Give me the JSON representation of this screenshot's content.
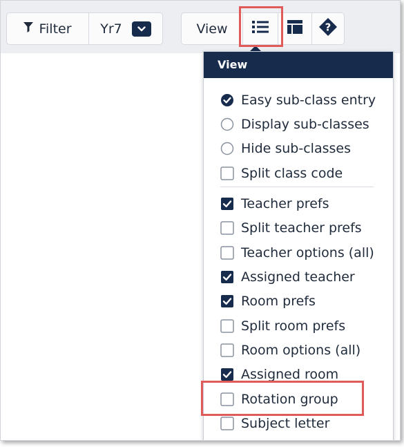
{
  "toolbar": {
    "filter_label": "Filter",
    "year_value": "Yr7",
    "view_label": "View"
  },
  "icons": {
    "filter": "funnel-icon",
    "year_dropdown": "chevron-down-icon",
    "list": "list-icon",
    "layout": "layout-icon",
    "help": "help-diamond-icon"
  },
  "colors": {
    "accent": "#172b4d",
    "highlight": "#e05a5a",
    "toolbar_bg": "#eceef1"
  },
  "view_menu": {
    "title": "View",
    "radio_options": [
      {
        "label": "Easy sub-class entry",
        "selected": true
      },
      {
        "label": "Display sub-classes",
        "selected": false
      },
      {
        "label": "Hide sub-classes",
        "selected": false
      }
    ],
    "split_class_code": {
      "label": "Split class code",
      "checked": false
    },
    "check_options": [
      {
        "label": "Teacher prefs",
        "checked": true
      },
      {
        "label": "Split teacher prefs",
        "checked": false
      },
      {
        "label": "Teacher options (all)",
        "checked": false
      },
      {
        "label": "Assigned teacher",
        "checked": true
      },
      {
        "label": "Room prefs",
        "checked": true
      },
      {
        "label": "Split room prefs",
        "checked": false
      },
      {
        "label": "Room options (all)",
        "checked": false
      },
      {
        "label": "Assigned room",
        "checked": true
      },
      {
        "label": "Rotation group",
        "checked": false
      },
      {
        "label": "Subject letter",
        "checked": false
      }
    ]
  }
}
